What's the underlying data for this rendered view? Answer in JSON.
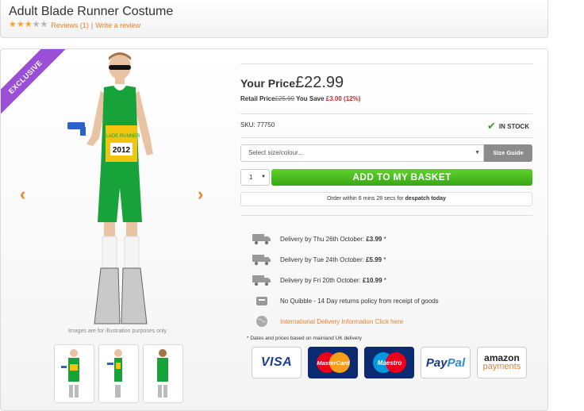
{
  "product": {
    "title": "Adult Blade Runner Costume",
    "rating": {
      "stars_filled": 3,
      "stars_total": 5
    },
    "reviews_link": "Reviews (1)",
    "separator": "|",
    "write_review_link": "Write a review"
  },
  "gallery": {
    "ribbon": "EXCLUSIVE",
    "prev_arrow": "‹",
    "next_arrow": "›",
    "illustration_note": "Images are for illustration purposes only",
    "figure": {
      "shirt_text": "BLADE RUNNER",
      "bib_number": "2012"
    },
    "thumbnails": [
      "front",
      "side",
      "back"
    ]
  },
  "pricing": {
    "your_price_label": "Your Price",
    "price": "£22.99",
    "retail_label": "Retail Price",
    "retail_price": "£25.99",
    "you_save_label": " You Save ",
    "you_save_value": "£3.00 (12%)"
  },
  "stock": {
    "sku": "SKU: 77750",
    "status": "IN STOCK"
  },
  "options": {
    "size_placeholder": "Select size/colour...",
    "size_guide": "Size Guide",
    "quantity": "1",
    "add_to_basket": "ADD TO MY BASKET",
    "despatch_prefix": "Order within 6 mins 28 secs for ",
    "despatch_bold": "despatch today"
  },
  "delivery": [
    {
      "icon": "truck-icon",
      "text": "Delivery by Thu 26th October: ",
      "price": "£3.99",
      "suffix": " *"
    },
    {
      "icon": "truck-icon",
      "text": "Delivery by Tue 24th October: ",
      "price": "£5.99",
      "suffix": " *"
    },
    {
      "icon": "truck-icon",
      "text": "Delivery by Fri 20th October: ",
      "price": "£10.99",
      "suffix": " *"
    },
    {
      "icon": "returns-icon",
      "text": "No Quibble - 14 Day returns policy from receipt of goods"
    },
    {
      "icon": "globe-icon",
      "link": "International Delivery Information Click here"
    }
  ],
  "footnote": "* Dates and prices based on mainland UK delivery",
  "payments": {
    "visa": "VISA",
    "mastercard": "MasterCard",
    "maestro": "Maestro",
    "paypal_a": "Pay",
    "paypal_b": "Pal",
    "amazon_a": "amazon",
    "amazon_b": "payments"
  },
  "colors": {
    "accent_orange": "#e8822a",
    "basket_green": "#4cbf22",
    "ribbon_purple": "#9b4fd6",
    "save_red": "#c62828"
  }
}
